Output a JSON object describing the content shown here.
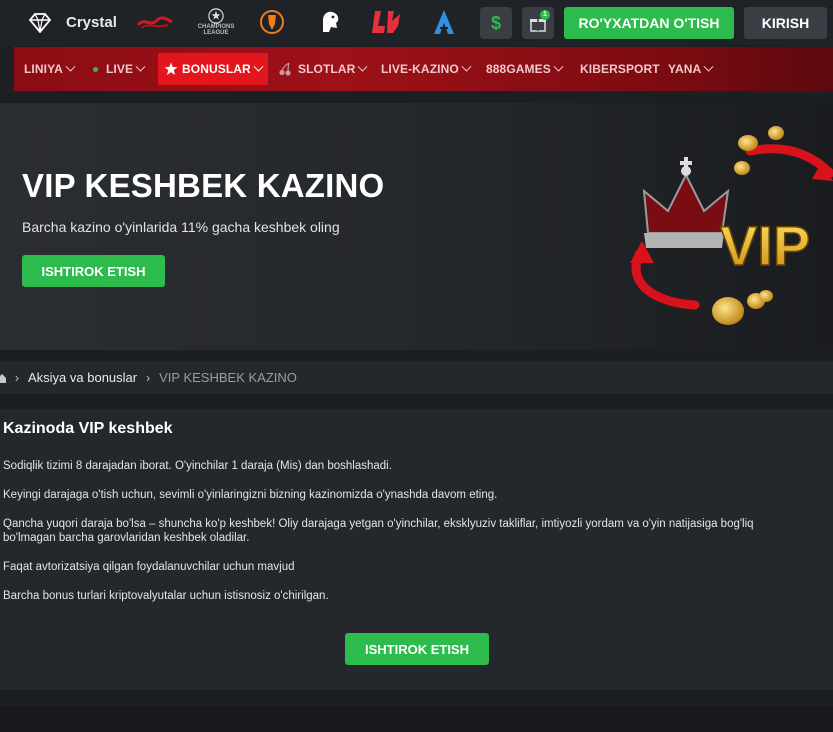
{
  "header": {
    "brand_name": "Crystal",
    "partner_logos": [
      "el-clasico-logo",
      "champions-league-logo",
      "europa-league-logo",
      "premier-league-logo",
      "laliga-logo",
      "serie-a-logo"
    ],
    "champions_label": "CHAMPIONS LEAGUE",
    "gift_badge": "1",
    "register_label": "RO'YXATDAN O'TISH",
    "login_label": "KIRISH"
  },
  "nav": {
    "items": [
      {
        "label": "LINIYA"
      },
      {
        "label": "LIVE"
      },
      {
        "label": "BONUSLAR"
      },
      {
        "label": "SLOTLAR"
      },
      {
        "label": "LIVE-KAZINO"
      },
      {
        "label": "888GAMES"
      },
      {
        "label": "KIBERSPORT"
      },
      {
        "label": "YANA"
      }
    ]
  },
  "hero": {
    "title": "VIP KESHBEK KAZINO",
    "subtitle": "Barcha kazino o'yinlarida 11% gacha keshbek oling",
    "button_label": "ISHTIROK ETISH",
    "art_text": "VIP"
  },
  "breadcrumb": {
    "link": "Aksiya va bonuslar",
    "current": "VIP KESHBEK KAZINO"
  },
  "content": {
    "heading": "Kazinoda VIP keshbek",
    "paragraphs": [
      "Sodiqlik tizimi 8 darajadan iborat. O'yinchilar 1 daraja (Mis) dan boshlashadi.",
      "Keyingi darajaga o'tish uchun, sevimli o'yinlaringizni bizning kazinomizda o'ynashda davom eting.",
      "Qancha yuqori daraja bo'lsa – shuncha ko'p keshbek! Oliy darajaga yetgan o'yinchilar, eksklyuziv takliflar, imtiyozli yordam va o'yin natijasiga bog'liq bo'lmagan barcha garovlaridan keshbek oladilar.",
      "Faqat avtorizatsiya qilgan foydalanuvchilar uchun mavjud",
      "Barcha bonus turlari kriptovalyutalar uchun istisnosiz o'chirilgan."
    ],
    "button_label": "ISHTIROK ETISH"
  },
  "colors": {
    "accent_green": "#2ebb4e",
    "nav_red": "#9e1119",
    "active_red": "#e3161e",
    "background": "#1b1e22"
  }
}
